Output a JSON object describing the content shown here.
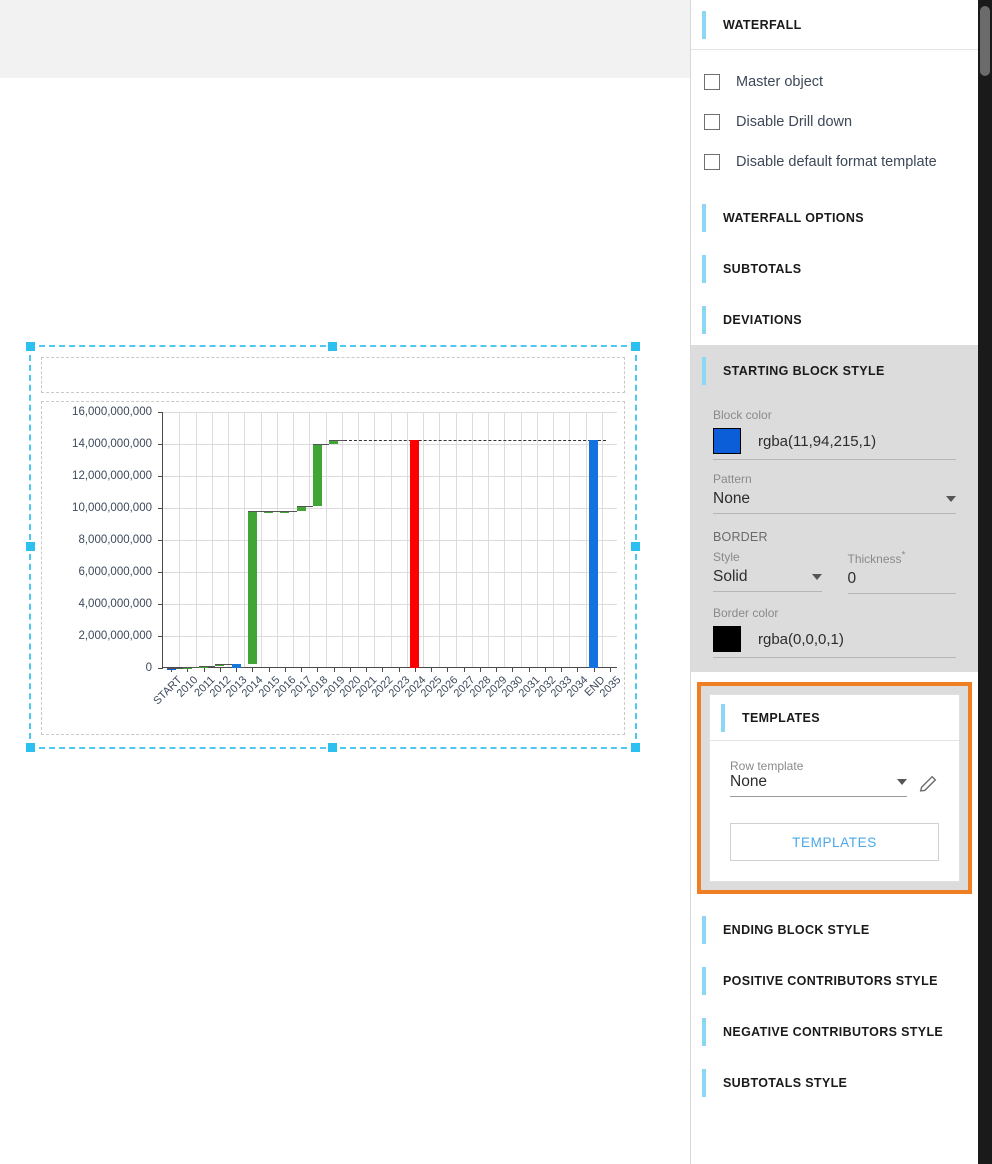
{
  "panel": {
    "title": "WATERFALL",
    "checkboxes": [
      {
        "label": "Master object",
        "checked": false
      },
      {
        "label": "Disable Drill down",
        "checked": false
      },
      {
        "label": "Disable default format template",
        "checked": false
      }
    ],
    "sections_top": [
      {
        "label": "WATERFALL OPTIONS"
      },
      {
        "label": "SUBTOTALS"
      },
      {
        "label": "DEVIATIONS"
      }
    ],
    "starting_block": {
      "header": "STARTING BLOCK STYLE",
      "block_color_label": "Block color",
      "block_color_value": "rgba(11,94,215,1)",
      "block_color_hex": "#0b5ed7",
      "pattern_label": "Pattern",
      "pattern_value": "None",
      "border_group_label": "BORDER",
      "border_style_label": "Style",
      "border_style_value": "Solid",
      "border_thickness_label": "Thickness",
      "border_thickness_required": "*",
      "border_thickness_value": "0",
      "border_color_label": "Border color",
      "border_color_value": "rgba(0,0,0,1)",
      "border_color_hex": "#000000"
    },
    "templates": {
      "header": "TEMPLATES",
      "row_template_label": "Row template",
      "row_template_value": "None",
      "button_label": "TEMPLATES",
      "highlight_color": "#ef7f22",
      "edit_icon": "pencil-icon"
    },
    "sections_bottom": [
      {
        "label": "ENDING BLOCK STYLE"
      },
      {
        "label": "POSITIVE CONTRIBUTORS STYLE"
      },
      {
        "label": "NEGATIVE CONTRIBUTORS STYLE"
      },
      {
        "label": "SUBTOTALS STYLE"
      }
    ]
  },
  "chart_data": {
    "type": "bar",
    "subtype": "waterfall",
    "title": "",
    "xlabel": "",
    "ylabel": "",
    "ylim": [
      0,
      16000000000
    ],
    "ytick_labels": [
      "0",
      "2,000,000,000",
      "4,000,000,000",
      "6,000,000,000",
      "8,000,000,000",
      "10,000,000,000",
      "12,000,000,000",
      "14,000,000,000",
      "16,000,000,000"
    ],
    "ytick_values": [
      0,
      2000000000,
      4000000000,
      6000000000,
      8000000000,
      10000000000,
      12000000000,
      14000000000,
      16000000000
    ],
    "grid": true,
    "legend": false,
    "categories": [
      "START",
      "2010",
      "2011",
      "2012",
      "2013",
      "2014",
      "2015",
      "2016",
      "2017",
      "2018",
      "2019",
      "2020",
      "2021",
      "2022",
      "2023",
      "2024",
      "2025",
      "2026",
      "2027",
      "2028",
      "2029",
      "2030",
      "2031",
      "2032",
      "2033",
      "2034",
      "END",
      "2035"
    ],
    "bars": [
      {
        "category": "START",
        "kind": "start",
        "base": 0,
        "top": 0,
        "color": "#0b5ed7"
      },
      {
        "category": "2010",
        "kind": "positive",
        "base": 0,
        "top": 60000000,
        "color": "#40a535"
      },
      {
        "category": "2011",
        "kind": "positive",
        "base": 60000000,
        "top": 130000000,
        "color": "#40a535"
      },
      {
        "category": "2012",
        "kind": "positive",
        "base": 130000000,
        "top": 230000000,
        "color": "#40a535"
      },
      {
        "category": "2013",
        "kind": "subtotal",
        "base": 0,
        "top": 230000000,
        "color": "#1878d8"
      },
      {
        "category": "2014",
        "kind": "positive",
        "base": 230000000,
        "top": 9800000000,
        "color": "#40a535"
      },
      {
        "category": "2015",
        "kind": "positive",
        "base": 9800000000,
        "top": 9820000000,
        "color": "#40a535"
      },
      {
        "category": "2016",
        "kind": "positive",
        "base": 9820000000,
        "top": 9840000000,
        "color": "#40a535"
      },
      {
        "category": "2017",
        "kind": "positive",
        "base": 9840000000,
        "top": 10100000000,
        "color": "#40a535"
      },
      {
        "category": "2018",
        "kind": "positive",
        "base": 10100000000,
        "top": 14000000000,
        "color": "#40a535"
      },
      {
        "category": "2019",
        "kind": "positive",
        "base": 14000000000,
        "top": 14250000000,
        "color": "#40a535"
      },
      {
        "category": "2024",
        "kind": "subtotal",
        "base": 0,
        "top": 14250000000,
        "color": "#ff0000"
      },
      {
        "category": "END",
        "kind": "end",
        "base": 0,
        "top": 14250000000,
        "color": "#1272e0"
      }
    ],
    "connector_level": 14250000000,
    "connector_style": "dashed",
    "colors": {
      "positive": "#40a535",
      "negative": "#ff0000",
      "subtotal": "#1878d8",
      "start": "#0b5ed7",
      "end": "#1272e0"
    }
  },
  "selection": {
    "selected": true,
    "handle_color": "#2cc0f0",
    "frame_color": "#4ec8f0"
  }
}
